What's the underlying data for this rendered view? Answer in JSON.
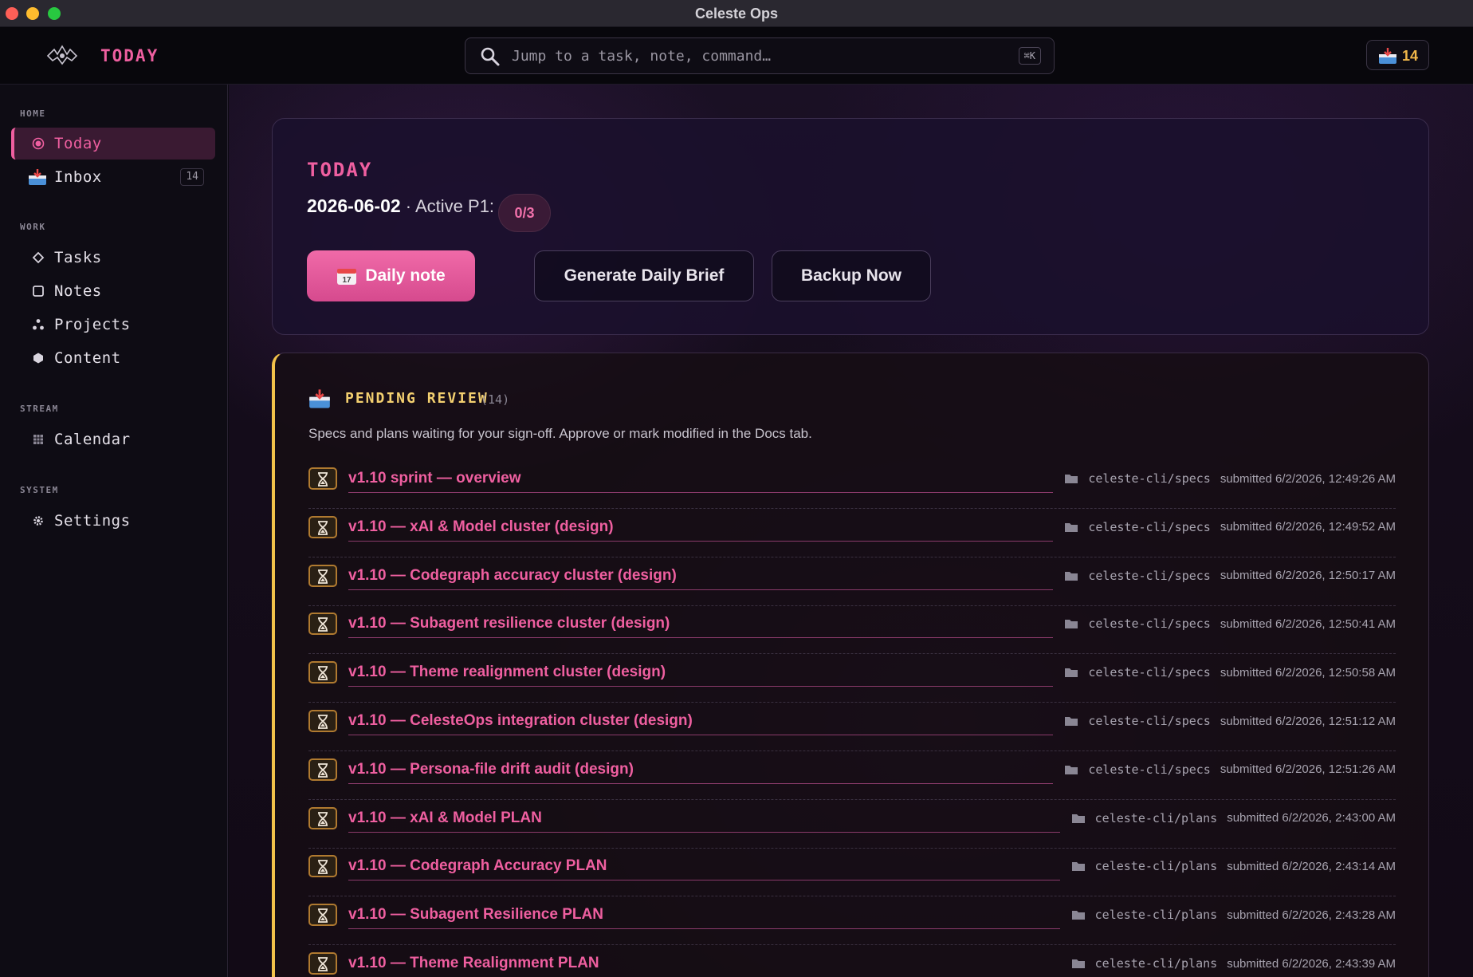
{
  "window": {
    "title": "Celeste Ops"
  },
  "topbar": {
    "title": "TODAY",
    "search_placeholder": "Jump to a task, note, command…",
    "search_shortcut": "⌘K",
    "inbox_count": "14"
  },
  "sidebar": {
    "sections": {
      "home": "HOME",
      "work": "WORK",
      "stream": "STREAM",
      "system": "SYSTEM"
    },
    "items": {
      "today": "Today",
      "inbox": "Inbox",
      "inbox_count": "14",
      "tasks": "Tasks",
      "notes": "Notes",
      "projects": "Projects",
      "content": "Content",
      "calendar": "Calendar",
      "settings": "Settings"
    }
  },
  "today_card": {
    "heading": "TODAY",
    "date": "2026-06-02",
    "active_label": " · Active P1:",
    "active_p1": "0/3",
    "buttons": {
      "daily_note": "Daily note",
      "generate_brief": "Generate Daily Brief",
      "backup_now": "Backup Now"
    }
  },
  "pending_review": {
    "title": "PENDING REVIEW",
    "count": "(14)",
    "description": "Specs and plans waiting for your sign-off. Approve or mark modified in the Docs tab.",
    "items": [
      {
        "title": "v1.10 sprint — overview",
        "path": "celeste-cli/specs",
        "submitted": "submitted 6/2/2026, 12:49:26 AM"
      },
      {
        "title": "v1.10 — xAI & Model cluster (design)",
        "path": "celeste-cli/specs",
        "submitted": "submitted 6/2/2026, 12:49:52 AM"
      },
      {
        "title": "v1.10 — Codegraph accuracy cluster (design)",
        "path": "celeste-cli/specs",
        "submitted": "submitted 6/2/2026, 12:50:17 AM"
      },
      {
        "title": "v1.10 — Subagent resilience cluster (design)",
        "path": "celeste-cli/specs",
        "submitted": "submitted 6/2/2026, 12:50:41 AM"
      },
      {
        "title": "v1.10 — Theme realignment cluster (design)",
        "path": "celeste-cli/specs",
        "submitted": "submitted 6/2/2026, 12:50:58 AM"
      },
      {
        "title": "v1.10 — CelesteOps integration cluster (design)",
        "path": "celeste-cli/specs",
        "submitted": "submitted 6/2/2026, 12:51:12 AM"
      },
      {
        "title": "v1.10 — Persona-file drift audit (design)",
        "path": "celeste-cli/specs",
        "submitted": "submitted 6/2/2026, 12:51:26 AM"
      },
      {
        "title": "v1.10 — xAI & Model PLAN",
        "path": "celeste-cli/plans",
        "submitted": "submitted 6/2/2026, 2:43:00 AM"
      },
      {
        "title": "v1.10 — Codegraph Accuracy PLAN",
        "path": "celeste-cli/plans",
        "submitted": "submitted 6/2/2026, 2:43:14 AM"
      },
      {
        "title": "v1.10 — Subagent Resilience PLAN",
        "path": "celeste-cli/plans",
        "submitted": "submitted 6/2/2026, 2:43:28 AM"
      },
      {
        "title": "v1.10 — Theme Realignment PLAN",
        "path": "celeste-cli/plans",
        "submitted": "submitted 6/2/2026, 2:43:39 AM"
      }
    ]
  },
  "colors": {
    "accent": "#ef5fa0",
    "review_accent": "#f2c24a",
    "badge": "#f2b84a"
  }
}
